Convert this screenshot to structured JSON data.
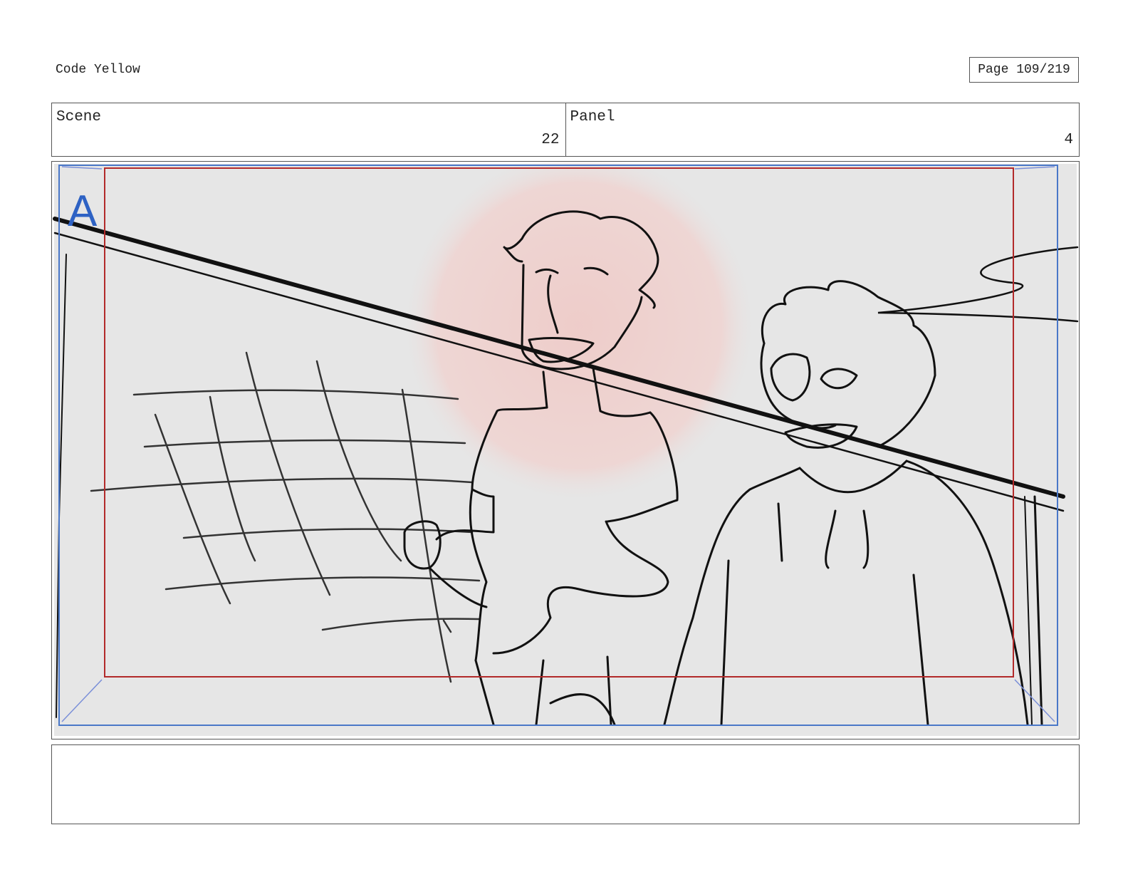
{
  "header": {
    "project_title": "Code Yellow",
    "page_label": "Page 109/219"
  },
  "info": {
    "scene_label": "Scene",
    "scene_value": "22",
    "panel_label": "Panel",
    "panel_value": "4"
  },
  "frame": {
    "safe_area_marker": "A",
    "colors": {
      "background": "#e6e6e6",
      "safe_frame": "#b22a2a",
      "camera_frame": "#4a78c8",
      "glow": "#f0cfcc",
      "ink": "#111111"
    }
  },
  "notes": {
    "text": ""
  }
}
